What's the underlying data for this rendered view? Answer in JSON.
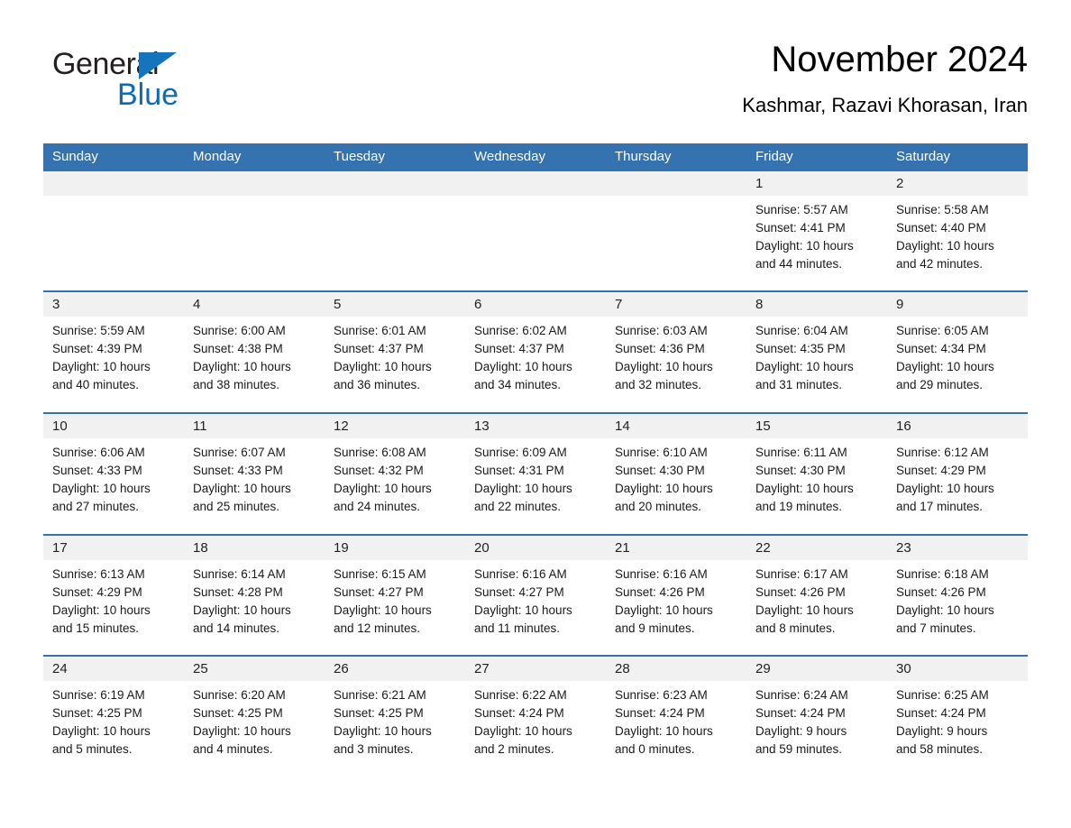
{
  "brand": {
    "name_part1": "General",
    "name_part2": "Blue",
    "triangle_color": "#1574bb",
    "blue_color": "#0f6ab4"
  },
  "header": {
    "title": "November 2024",
    "subtitle": "Kashmar, Razavi Khorasan, Iran"
  },
  "theme": {
    "header_blue": "#3572b0",
    "date_band_gray": "#f1f1f1",
    "cell_white": "#ffffff",
    "text_black": "#1a1a1a"
  },
  "calendar": {
    "day_headers": [
      "Sunday",
      "Monday",
      "Tuesday",
      "Wednesday",
      "Thursday",
      "Friday",
      "Saturday"
    ],
    "weeks": [
      {
        "dates": [
          "",
          "",
          "",
          "",
          "",
          "1",
          "2"
        ],
        "cells": [
          {
            "sunrise": "",
            "sunset": "",
            "daylight_line1": "",
            "daylight_line2": ""
          },
          {
            "sunrise": "",
            "sunset": "",
            "daylight_line1": "",
            "daylight_line2": ""
          },
          {
            "sunrise": "",
            "sunset": "",
            "daylight_line1": "",
            "daylight_line2": ""
          },
          {
            "sunrise": "",
            "sunset": "",
            "daylight_line1": "",
            "daylight_line2": ""
          },
          {
            "sunrise": "",
            "sunset": "",
            "daylight_line1": "",
            "daylight_line2": ""
          },
          {
            "sunrise": "Sunrise: 5:57 AM",
            "sunset": "Sunset: 4:41 PM",
            "daylight_line1": "Daylight: 10 hours",
            "daylight_line2": "and 44 minutes."
          },
          {
            "sunrise": "Sunrise: 5:58 AM",
            "sunset": "Sunset: 4:40 PM",
            "daylight_line1": "Daylight: 10 hours",
            "daylight_line2": "and 42 minutes."
          }
        ]
      },
      {
        "dates": [
          "3",
          "4",
          "5",
          "6",
          "7",
          "8",
          "9"
        ],
        "cells": [
          {
            "sunrise": "Sunrise: 5:59 AM",
            "sunset": "Sunset: 4:39 PM",
            "daylight_line1": "Daylight: 10 hours",
            "daylight_line2": "and 40 minutes."
          },
          {
            "sunrise": "Sunrise: 6:00 AM",
            "sunset": "Sunset: 4:38 PM",
            "daylight_line1": "Daylight: 10 hours",
            "daylight_line2": "and 38 minutes."
          },
          {
            "sunrise": "Sunrise: 6:01 AM",
            "sunset": "Sunset: 4:37 PM",
            "daylight_line1": "Daylight: 10 hours",
            "daylight_line2": "and 36 minutes."
          },
          {
            "sunrise": "Sunrise: 6:02 AM",
            "sunset": "Sunset: 4:37 PM",
            "daylight_line1": "Daylight: 10 hours",
            "daylight_line2": "and 34 minutes."
          },
          {
            "sunrise": "Sunrise: 6:03 AM",
            "sunset": "Sunset: 4:36 PM",
            "daylight_line1": "Daylight: 10 hours",
            "daylight_line2": "and 32 minutes."
          },
          {
            "sunrise": "Sunrise: 6:04 AM",
            "sunset": "Sunset: 4:35 PM",
            "daylight_line1": "Daylight: 10 hours",
            "daylight_line2": "and 31 minutes."
          },
          {
            "sunrise": "Sunrise: 6:05 AM",
            "sunset": "Sunset: 4:34 PM",
            "daylight_line1": "Daylight: 10 hours",
            "daylight_line2": "and 29 minutes."
          }
        ]
      },
      {
        "dates": [
          "10",
          "11",
          "12",
          "13",
          "14",
          "15",
          "16"
        ],
        "cells": [
          {
            "sunrise": "Sunrise: 6:06 AM",
            "sunset": "Sunset: 4:33 PM",
            "daylight_line1": "Daylight: 10 hours",
            "daylight_line2": "and 27 minutes."
          },
          {
            "sunrise": "Sunrise: 6:07 AM",
            "sunset": "Sunset: 4:33 PM",
            "daylight_line1": "Daylight: 10 hours",
            "daylight_line2": "and 25 minutes."
          },
          {
            "sunrise": "Sunrise: 6:08 AM",
            "sunset": "Sunset: 4:32 PM",
            "daylight_line1": "Daylight: 10 hours",
            "daylight_line2": "and 24 minutes."
          },
          {
            "sunrise": "Sunrise: 6:09 AM",
            "sunset": "Sunset: 4:31 PM",
            "daylight_line1": "Daylight: 10 hours",
            "daylight_line2": "and 22 minutes."
          },
          {
            "sunrise": "Sunrise: 6:10 AM",
            "sunset": "Sunset: 4:30 PM",
            "daylight_line1": "Daylight: 10 hours",
            "daylight_line2": "and 20 minutes."
          },
          {
            "sunrise": "Sunrise: 6:11 AM",
            "sunset": "Sunset: 4:30 PM",
            "daylight_line1": "Daylight: 10 hours",
            "daylight_line2": "and 19 minutes."
          },
          {
            "sunrise": "Sunrise: 6:12 AM",
            "sunset": "Sunset: 4:29 PM",
            "daylight_line1": "Daylight: 10 hours",
            "daylight_line2": "and 17 minutes."
          }
        ]
      },
      {
        "dates": [
          "17",
          "18",
          "19",
          "20",
          "21",
          "22",
          "23"
        ],
        "cells": [
          {
            "sunrise": "Sunrise: 6:13 AM",
            "sunset": "Sunset: 4:29 PM",
            "daylight_line1": "Daylight: 10 hours",
            "daylight_line2": "and 15 minutes."
          },
          {
            "sunrise": "Sunrise: 6:14 AM",
            "sunset": "Sunset: 4:28 PM",
            "daylight_line1": "Daylight: 10 hours",
            "daylight_line2": "and 14 minutes."
          },
          {
            "sunrise": "Sunrise: 6:15 AM",
            "sunset": "Sunset: 4:27 PM",
            "daylight_line1": "Daylight: 10 hours",
            "daylight_line2": "and 12 minutes."
          },
          {
            "sunrise": "Sunrise: 6:16 AM",
            "sunset": "Sunset: 4:27 PM",
            "daylight_line1": "Daylight: 10 hours",
            "daylight_line2": "and 11 minutes."
          },
          {
            "sunrise": "Sunrise: 6:16 AM",
            "sunset": "Sunset: 4:26 PM",
            "daylight_line1": "Daylight: 10 hours",
            "daylight_line2": "and 9 minutes."
          },
          {
            "sunrise": "Sunrise: 6:17 AM",
            "sunset": "Sunset: 4:26 PM",
            "daylight_line1": "Daylight: 10 hours",
            "daylight_line2": "and 8 minutes."
          },
          {
            "sunrise": "Sunrise: 6:18 AM",
            "sunset": "Sunset: 4:26 PM",
            "daylight_line1": "Daylight: 10 hours",
            "daylight_line2": "and 7 minutes."
          }
        ]
      },
      {
        "dates": [
          "24",
          "25",
          "26",
          "27",
          "28",
          "29",
          "30"
        ],
        "cells": [
          {
            "sunrise": "Sunrise: 6:19 AM",
            "sunset": "Sunset: 4:25 PM",
            "daylight_line1": "Daylight: 10 hours",
            "daylight_line2": "and 5 minutes."
          },
          {
            "sunrise": "Sunrise: 6:20 AM",
            "sunset": "Sunset: 4:25 PM",
            "daylight_line1": "Daylight: 10 hours",
            "daylight_line2": "and 4 minutes."
          },
          {
            "sunrise": "Sunrise: 6:21 AM",
            "sunset": "Sunset: 4:25 PM",
            "daylight_line1": "Daylight: 10 hours",
            "daylight_line2": "and 3 minutes."
          },
          {
            "sunrise": "Sunrise: 6:22 AM",
            "sunset": "Sunset: 4:24 PM",
            "daylight_line1": "Daylight: 10 hours",
            "daylight_line2": "and 2 minutes."
          },
          {
            "sunrise": "Sunrise: 6:23 AM",
            "sunset": "Sunset: 4:24 PM",
            "daylight_line1": "Daylight: 10 hours",
            "daylight_line2": "and 0 minutes."
          },
          {
            "sunrise": "Sunrise: 6:24 AM",
            "sunset": "Sunset: 4:24 PM",
            "daylight_line1": "Daylight: 9 hours",
            "daylight_line2": "and 59 minutes."
          },
          {
            "sunrise": "Sunrise: 6:25 AM",
            "sunset": "Sunset: 4:24 PM",
            "daylight_line1": "Daylight: 9 hours",
            "daylight_line2": "and 58 minutes."
          }
        ]
      }
    ]
  }
}
